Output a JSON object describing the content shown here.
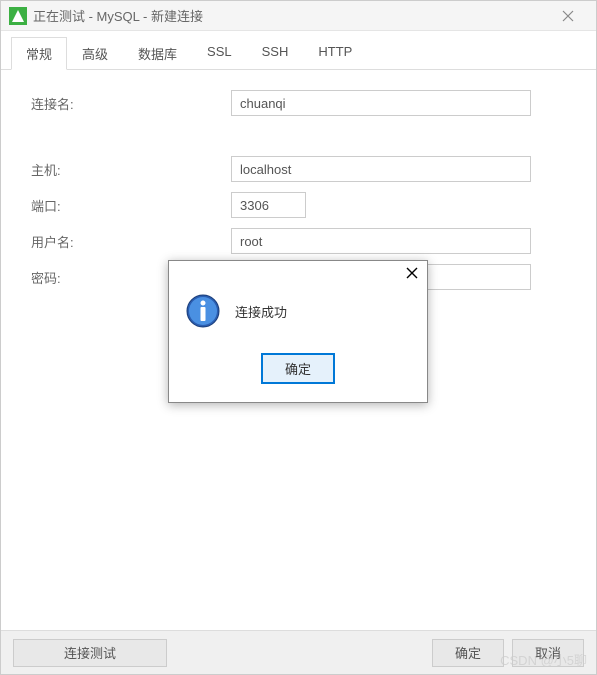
{
  "titlebar": {
    "title": "正在测试 - MySQL - 新建连接"
  },
  "tabs": [
    {
      "label": "常规",
      "active": true
    },
    {
      "label": "高级",
      "active": false
    },
    {
      "label": "数据库",
      "active": false
    },
    {
      "label": "SSL",
      "active": false
    },
    {
      "label": "SSH",
      "active": false
    },
    {
      "label": "HTTP",
      "active": false
    }
  ],
  "form": {
    "connection_name_label": "连接名:",
    "connection_name_value": "chuanqi",
    "host_label": "主机:",
    "host_value": "localhost",
    "port_label": "端口:",
    "port_value": "3306",
    "username_label": "用户名:",
    "username_value": "root",
    "password_label": "密码:",
    "password_value": "•••••••"
  },
  "footer": {
    "test_label": "连接测试",
    "ok_label": "确定",
    "cancel_label": "取消"
  },
  "modal": {
    "message": "连接成功",
    "ok_label": "确定"
  },
  "watermark": "CSDN @小5聊"
}
